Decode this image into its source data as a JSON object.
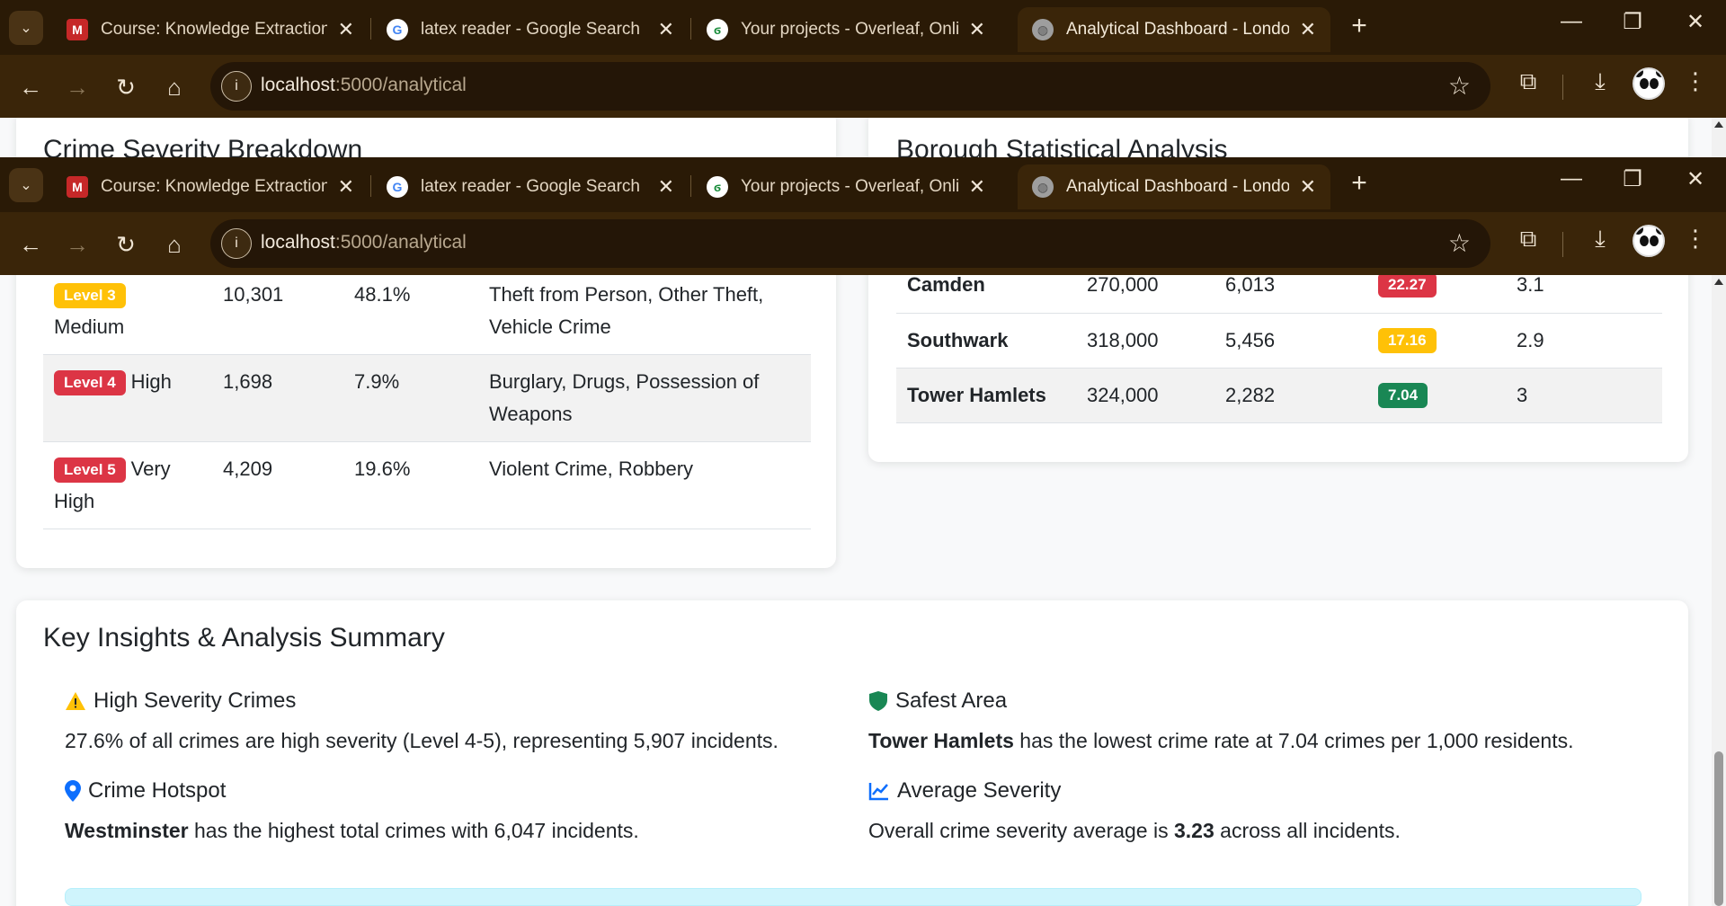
{
  "browser": {
    "tabs": [
      {
        "title": "Course: Knowledge Extraction, I",
        "icon": "moodle-icon",
        "close": "✕"
      },
      {
        "title": "latex reader - Google Search",
        "icon": "google-icon",
        "close": "✕"
      },
      {
        "title": "Your projects - Overleaf, Online",
        "icon": "overleaf-icon",
        "close": "✕"
      },
      {
        "title": "Analytical Dashboard - London",
        "icon": "globe-icon",
        "close": "✕"
      }
    ],
    "url_host": "localhost",
    "url_path": ":5000/analytical",
    "new_tab": "+",
    "window_controls": {
      "minimize": "—",
      "restore": "❐",
      "close": "✕"
    }
  },
  "severity_card": {
    "title": "Crime Severity Breakdown",
    "rows": [
      {
        "badge": "Level 3",
        "badge_color": "#ffc107",
        "label": "Medium",
        "count": "10,301",
        "pct": "48.1%",
        "types": "Theft from Person, Other Theft, Vehicle Crime"
      },
      {
        "badge": "Level 4",
        "badge_color": "#dc3545",
        "label": "High",
        "count": "1,698",
        "pct": "7.9%",
        "types": "Burglary, Drugs, Possession of Weapons"
      },
      {
        "badge": "Level 5",
        "badge_color": "#dc3545",
        "label": "Very High",
        "count": "4,209",
        "pct": "19.6%",
        "types": "Violent Crime, Robbery"
      }
    ]
  },
  "borough_card": {
    "title": "Borough Statistical Analysis",
    "rows": [
      {
        "name": "Camden",
        "population": "270,000",
        "crimes": "6,013",
        "rate": "22.27",
        "rate_color": "#dc3545",
        "severity": "3.1"
      },
      {
        "name": "Southwark",
        "population": "318,000",
        "crimes": "5,456",
        "rate": "17.16",
        "rate_color": "#ffc107",
        "severity": "2.9"
      },
      {
        "name": "Tower Hamlets",
        "population": "324,000",
        "crimes": "2,282",
        "rate": "7.04",
        "rate_color": "#198754",
        "severity": "3"
      }
    ]
  },
  "insights": {
    "title": "Key Insights & Analysis Summary",
    "high_severity": {
      "heading": "High Severity Crimes",
      "text": "27.6% of all crimes are high severity (Level 4-5), representing 5,907 incidents.",
      "icon_color": "#ffc107"
    },
    "safest": {
      "heading": "Safest Area",
      "bold": "Tower Hamlets",
      "text": " has the lowest crime rate at 7.04 crimes per 1,000 residents.",
      "icon_color": "#198754"
    },
    "hotspot": {
      "heading": "Crime Hotspot",
      "bold": "Westminster",
      "text": " has the highest total crimes with 6,047 incidents.",
      "icon_color": "#0d6efd"
    },
    "average": {
      "heading": "Average Severity",
      "text_before": "Overall crime severity average is ",
      "bold": "3.23",
      "text_after": " across all incidents.",
      "icon_color": "#0d6efd"
    }
  }
}
